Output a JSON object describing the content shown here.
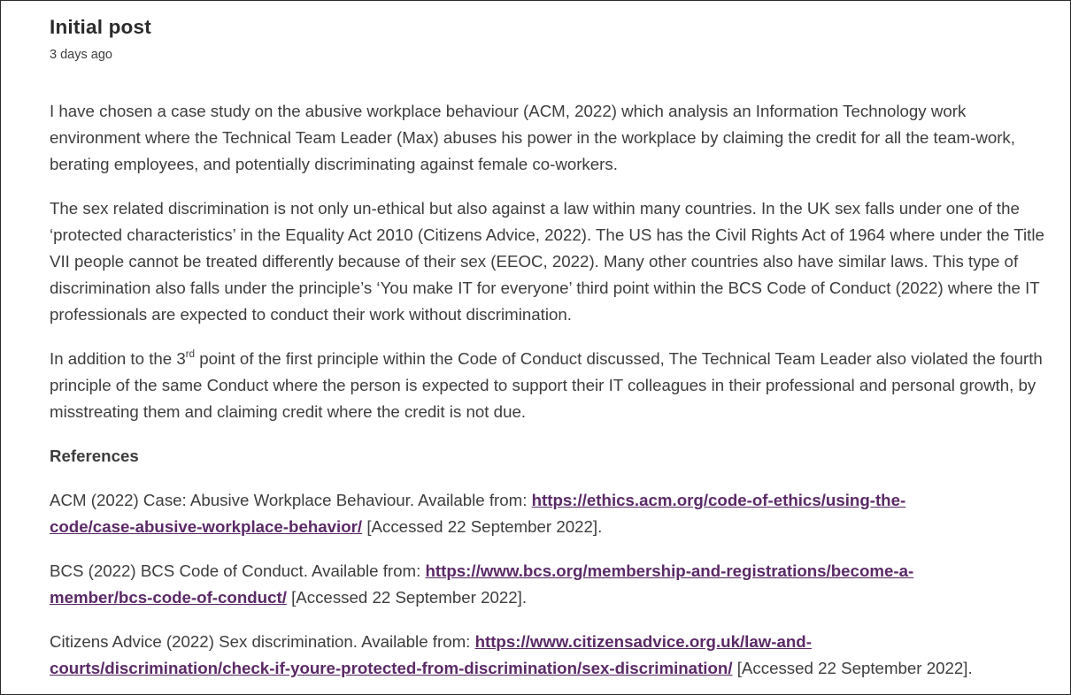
{
  "post": {
    "title": "Initial post",
    "timestamp": "3 days ago"
  },
  "paragraphs": [
    "I have chosen a case study on the abusive workplace behaviour (ACM, 2022) which analysis an Information Technology work environment where the Technical Team Leader (Max) abuses his power in the workplace by claiming the credit for all the team-work, berating employees, and potentially discriminating against female co-workers.",
    "The sex related discrimination is not only un-ethical but also against a law within many countries. In the UK sex falls under one of the ‘protected characteristics’ in the Equality Act 2010 (Citizens Advice, 2022). The US has the Civil Rights Act of 1964 where under the Title VII people cannot be treated differently because of their sex (EEOC, 2022). Many other countries also have similar laws. This type of discrimination also falls under the principle’s ‘You make IT for everyone’ third point within the BCS Code of Conduct (2022) where the IT professionals are expected to conduct their work without discrimination."
  ],
  "third_paragraph": {
    "before": "In addition to the 3",
    "sup": "rd",
    "after": " point of the first principle within the Code of Conduct discussed, The Technical Team Leader also violated the fourth principle of the same Conduct where the person is expected to support their IT colleagues in their professional and personal growth, by misstreating them and claiming credit where the credit is not due."
  },
  "references": {
    "heading": "References",
    "items": [
      {
        "text": "ACM (2022) Case: Abusive Workplace Behaviour. Available from: ",
        "url_line1": "https://ethics.acm.org/code-of-ethics/using-the-",
        "url_line2": "code/case-abusive-workplace-behavior/",
        "accessed": " [Accessed 22 September 2022]."
      },
      {
        "text": "BCS (2022) BCS Code of Conduct. Available from: ",
        "url_line1": "https://www.bcs.org/membership-and-registrations/become-a-",
        "url_line2": "member/bcs-code-of-conduct/",
        "accessed": " [Accessed 22 September 2022]."
      },
      {
        "text": "Citizens Advice (2022) Sex discrimination. Available from: ",
        "url_line1": "https://www.citizensadvice.org.uk/law-and-",
        "url_line2": "courts/discrimination/check-if-youre-protected-from-discrimination/sex-discrimination/",
        "accessed": " [Accessed 22 September 2022]."
      }
    ]
  },
  "colors": {
    "text": "#3d3d3d",
    "link": "#5b2a67",
    "border": "#2b2b2b"
  }
}
